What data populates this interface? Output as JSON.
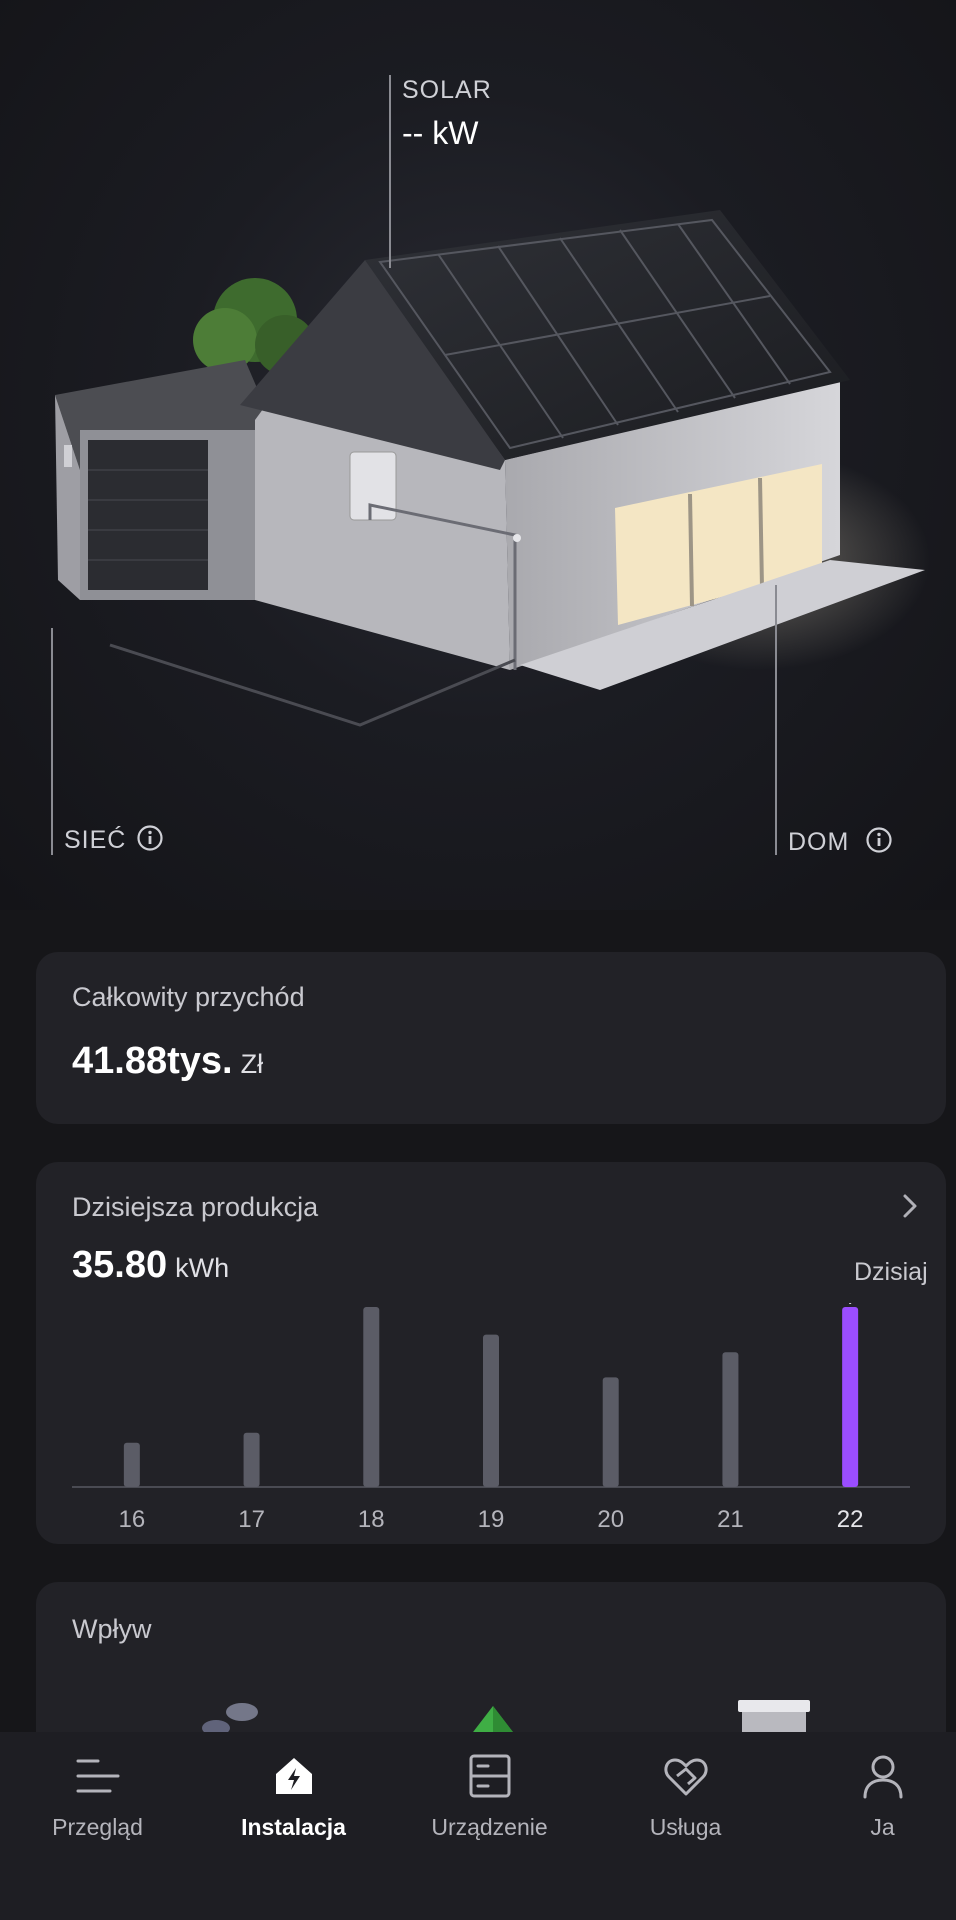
{
  "energy_flow": {
    "solar_label": "SOLAR",
    "solar_value": "-- kW",
    "grid_label": "SIEĆ",
    "home_label": "DOM"
  },
  "revenue_card": {
    "title": "Całkowity przychód",
    "value": "41.88tys.",
    "unit": "Zł"
  },
  "production_card": {
    "title": "Dzisiejsza produkcja",
    "value": "35.80",
    "unit": "kWh",
    "today_label": "Dzisiaj"
  },
  "chart_data": {
    "type": "bar",
    "categories": [
      "16",
      "17",
      "18",
      "19",
      "20",
      "21",
      "22"
    ],
    "values": [
      8.8,
      10.8,
      35.8,
      30.3,
      21.8,
      26.8,
      35.8
    ],
    "highlight_index": 6,
    "colors": {
      "normal": "#5b5c66",
      "highlight": "#9b4dff"
    }
  },
  "impact_card": {
    "title": "Wpływ"
  },
  "nav": {
    "items": [
      {
        "label": "Przegląd",
        "icon": "overview-icon"
      },
      {
        "label": "Instalacja",
        "icon": "installation-icon"
      },
      {
        "label": "Urządzenie",
        "icon": "device-icon"
      },
      {
        "label": "Usługa",
        "icon": "service-icon"
      },
      {
        "label": "Ja",
        "icon": "profile-icon"
      }
    ],
    "active_index": 1
  }
}
